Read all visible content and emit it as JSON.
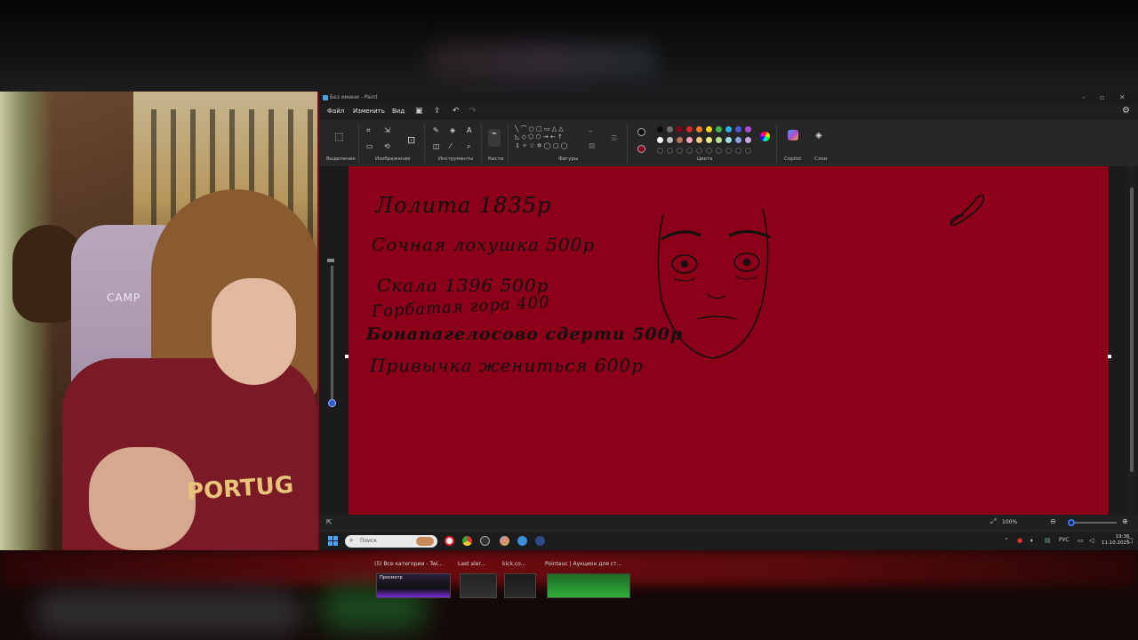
{
  "window": {
    "title": "Без имени - Paint"
  },
  "menu": {
    "file": "Файл",
    "edit": "Изменить",
    "view": "Вид"
  },
  "ribbon": {
    "groups": {
      "selection": "Выделение",
      "image": "Изображение",
      "tools": "Инструменты",
      "brushes": "Кисти",
      "shapes": "Фигуры",
      "colors": "Цвета",
      "copilot": "Copilot",
      "layers": "Слои"
    },
    "palette_row1": [
      "#0d0d0d",
      "#6e6e6e",
      "#8b0018",
      "#d62828",
      "#f07a2a",
      "#f4d51a",
      "#3cb84b",
      "#2fb2e6",
      "#4a5ad6",
      "#b04ad6"
    ],
    "palette_row2": [
      "#ffffff",
      "#c3c3c3",
      "#b5735a",
      "#f3a6b8",
      "#f8c97a",
      "#f0ea8a",
      "#b6e28a",
      "#9fe0ee",
      "#8aa3e6",
      "#c9a7e6"
    ],
    "active_color": "#0d0d0d",
    "secondary_color": "#8b0018"
  },
  "canvas": {
    "background": "#8b0018",
    "lines": [
      {
        "text": "Лолита  1835р"
      },
      {
        "text": "Сочная лохушка 500р"
      },
      {
        "text": "Скала 1396      500р"
      },
      {
        "text": "Горбатая гора 400"
      },
      {
        "text": "Бонапагелосово сдерти 500р"
      },
      {
        "text": "Привычка жениться 600р"
      }
    ]
  },
  "status": {
    "zoom": "100%"
  },
  "taskbar": {
    "search_placeholder": "Поиск",
    "time": "19:36",
    "date": "11.10.2025",
    "lang": "РУС",
    "previews": [
      {
        "label": "(5) Все категории - Twi...",
        "sub": "Просмотр"
      },
      {
        "label": "Last aler..."
      },
      {
        "label": "kick.co..."
      },
      {
        "label": "Pointauc | Аукцион для ст..."
      }
    ]
  },
  "webcam": {
    "chair_text": "CAMP",
    "shirt_text": "PORTUG"
  }
}
